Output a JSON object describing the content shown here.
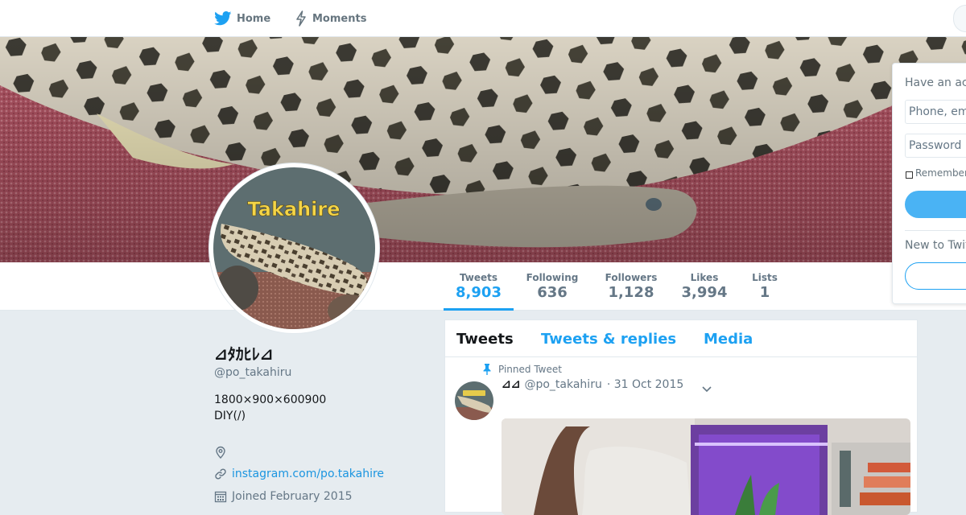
{
  "nav": {
    "home_label": "Home",
    "moments_label": "Moments"
  },
  "avatar_text": "Takahire",
  "stats": [
    {
      "label": "Tweets",
      "value": "8,903"
    },
    {
      "label": "Following",
      "value": "636"
    },
    {
      "label": "Followers",
      "value": "1,128"
    },
    {
      "label": "Likes",
      "value": "3,994"
    },
    {
      "label": "Lists",
      "value": "1"
    }
  ],
  "login": {
    "header": "Have an ac",
    "phone_placeholder": "Phone, em",
    "password_placeholder": "Password",
    "remember_label": "Remember",
    "new_prompt": "New to Twit"
  },
  "profile": {
    "name": "⊿ﾀｶﾋﾚ⊿",
    "handle": "@po_takahiru",
    "bio_line1": "1800×900×600900",
    "bio_line2": "DIY(/)",
    "location": "",
    "website": "instagram.com/po.takahire",
    "joined": "Joined February 2015"
  },
  "timeline": {
    "tabs": [
      "Tweets",
      "Tweets & replies",
      "Media"
    ],
    "pinned_label": "Pinned Tweet",
    "tweet": {
      "name": "⊿⊿",
      "handle": "@po_takahiru",
      "date": "· 31 Oct 2015"
    }
  },
  "colors": {
    "accent": "#1da1f2",
    "link": "#1b95e0",
    "background": "#e6ecf0",
    "muted": "#657786"
  }
}
